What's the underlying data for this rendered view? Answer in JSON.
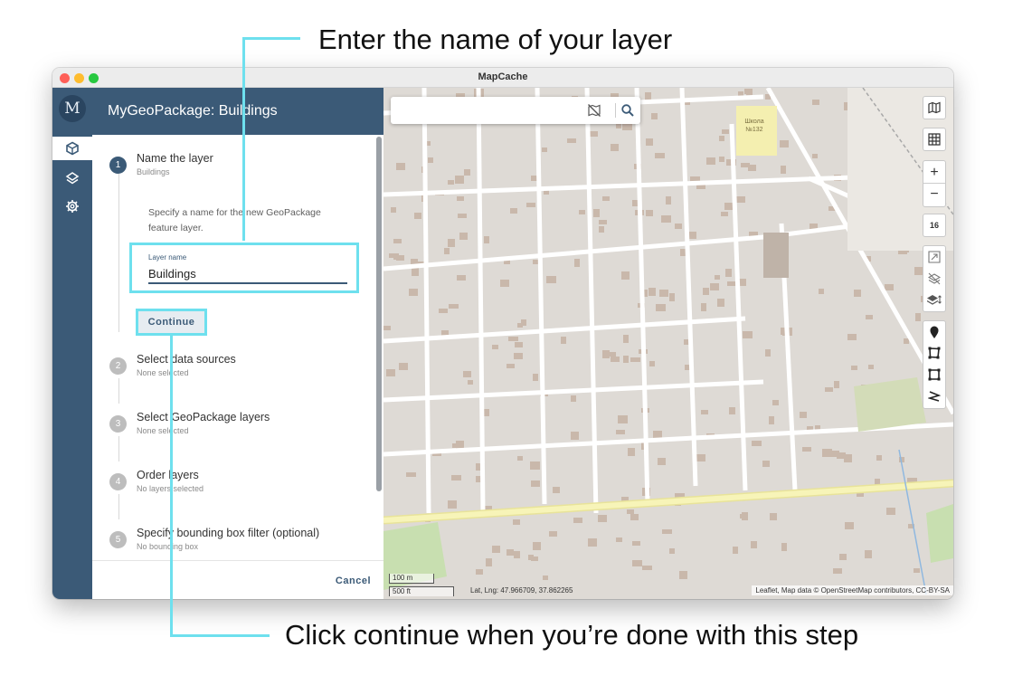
{
  "annotations": {
    "top": "Enter the name of your layer",
    "bottom": "Click continue when you’re done with this step"
  },
  "window": {
    "title": "MapCache"
  },
  "header": {
    "title": "MyGeoPackage: Buildings"
  },
  "rail": {
    "items": [
      {
        "name": "geopackage-icon",
        "glyph": "⬡"
      },
      {
        "name": "layers-icon",
        "glyph": "◈"
      },
      {
        "name": "settings-icon",
        "glyph": "⚙"
      }
    ]
  },
  "steps": [
    {
      "number": "1",
      "title": "Name the layer",
      "subtitle": "Buildings"
    },
    {
      "number": "2",
      "title": "Select data sources",
      "subtitle": "None selected"
    },
    {
      "number": "3",
      "title": "Select GeoPackage layers",
      "subtitle": "None selected"
    },
    {
      "number": "4",
      "title": "Order layers",
      "subtitle": "No layers selected"
    },
    {
      "number": "5",
      "title": "Specify bounding box filter (optional)",
      "subtitle": "No bounding box"
    }
  ],
  "step1": {
    "description": "Specify a name for the new GeoPackage feature layer.",
    "field_label": "Layer name",
    "field_value": "Buildings",
    "continue_label": "Continue"
  },
  "footer": {
    "cancel_label": "Cancel"
  },
  "map": {
    "zoom": "16",
    "scale_metric": "100 m",
    "scale_imperial": "500 ft",
    "latlng": "Lat, Lng: 47.966709, 37.862265",
    "attribution": "Leaflet, Map data © OpenStreetMap contributors, CC-BY-SA",
    "school_label": "Школа №132",
    "colors": {
      "background": "#dedad5",
      "road": "#ffffff",
      "building": "#c9b8ab",
      "main_road": "#f4f1a8",
      "park": "#c8dfb0"
    }
  },
  "colors": {
    "accent": "#3b5a77",
    "highlight": "#6ee0ee"
  }
}
